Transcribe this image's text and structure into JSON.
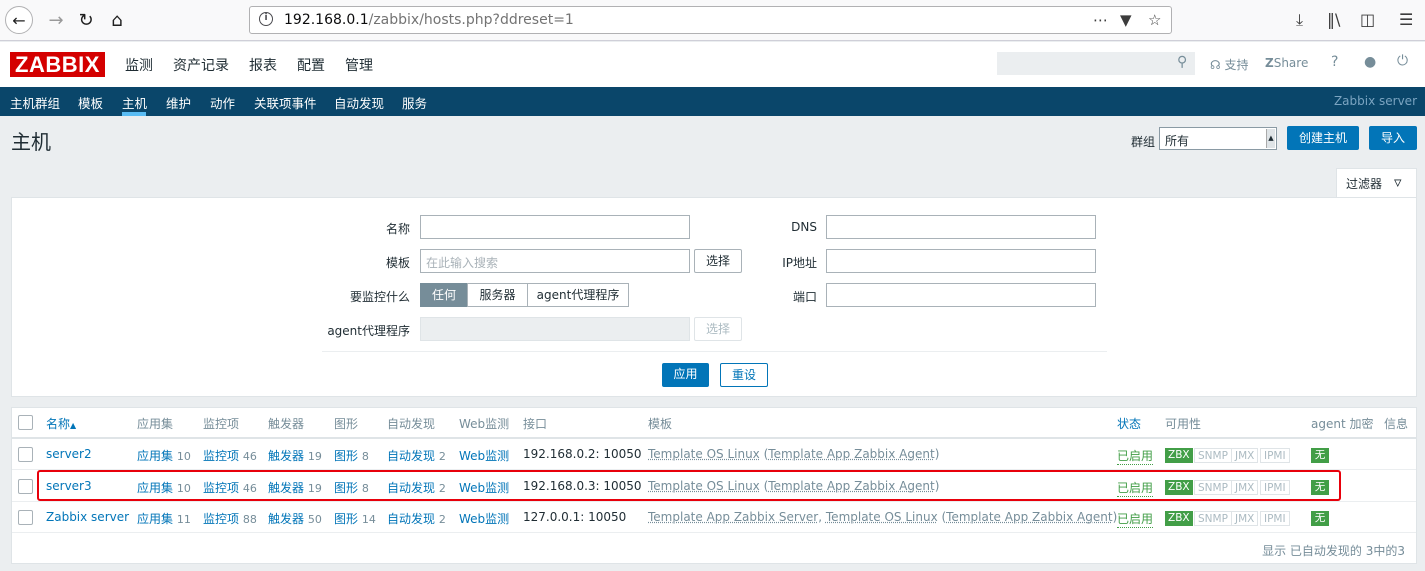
{
  "browser": {
    "url_host": "192.168.0.1",
    "url_path": "/zabbix/hosts.php?ddreset=1"
  },
  "header": {
    "logo": "ZABBIX",
    "menu": [
      "监测",
      "资产记录",
      "报表",
      "配置",
      "管理"
    ],
    "support": "支持",
    "share": "Share",
    "help": "?"
  },
  "subnav": {
    "items": [
      "主机群组",
      "模板",
      "主机",
      "维护",
      "动作",
      "关联项事件",
      "自动发现",
      "服务"
    ],
    "server_name": "Zabbix server"
  },
  "page": {
    "title": "主机",
    "group_label": "群组",
    "group_value": "所有",
    "create_button": "创建主机",
    "import_button": "导入"
  },
  "filter": {
    "tab_label": "过滤器",
    "name_label": "名称",
    "template_label": "模板",
    "template_placeholder": "在此输入搜索",
    "select_button": "选择",
    "monitored_by_label": "要监控什么",
    "monitored_options": [
      "任何",
      "服务器",
      "agent代理程序"
    ],
    "proxy_label": "agent代理程序",
    "dns_label": "DNS",
    "ip_label": "IP地址",
    "port_label": "端口",
    "apply_button": "应用",
    "reset_button": "重设"
  },
  "table": {
    "columns": {
      "name": "名称",
      "name_sort": "▲",
      "apps": "应用集",
      "items": "监控项",
      "triggers": "触发器",
      "graphs": "图形",
      "discovery": "自动发现",
      "web": "Web监测",
      "interface": "接口",
      "templates": "模板",
      "status": "状态",
      "availability": "可用性",
      "encryption": "agent 加密",
      "info": "信息"
    },
    "rows": [
      {
        "name": "server2",
        "apps_label": "应用集",
        "apps_count": "10",
        "items_label": "监控项",
        "items_count": "46",
        "triggers_label": "触发器",
        "triggers_count": "19",
        "graphs_label": "图形",
        "graphs_count": "8",
        "discovery_label": "自动发现",
        "discovery_count": "2",
        "web_label": "Web监测",
        "interface": "192.168.0.2: 10050",
        "tpl1": "Template OS Linux",
        "tpl_open": " (",
        "tpl2": "Template App Zabbix Agent",
        "tpl_close": ")",
        "status": "已启用",
        "avail": [
          "ZBX",
          "SNMP",
          "JMX",
          "IPMI"
        ],
        "encryption": "无"
      },
      {
        "name": "server3",
        "apps_label": "应用集",
        "apps_count": "10",
        "items_label": "监控项",
        "items_count": "46",
        "triggers_label": "触发器",
        "triggers_count": "19",
        "graphs_label": "图形",
        "graphs_count": "8",
        "discovery_label": "自动发现",
        "discovery_count": "2",
        "web_label": "Web监测",
        "interface": "192.168.0.3: 10050",
        "tpl1": "Template OS Linux",
        "tpl_open": " (",
        "tpl2": "Template App Zabbix Agent",
        "tpl_close": ")",
        "status": "已启用",
        "avail": [
          "ZBX",
          "SNMP",
          "JMX",
          "IPMI"
        ],
        "encryption": "无"
      },
      {
        "name": "Zabbix server",
        "apps_label": "应用集",
        "apps_count": "11",
        "items_label": "监控项",
        "items_count": "88",
        "triggers_label": "触发器",
        "triggers_count": "50",
        "graphs_label": "图形",
        "graphs_count": "14",
        "discovery_label": "自动发现",
        "discovery_count": "2",
        "web_label": "Web监测",
        "interface": "127.0.0.1: 10050",
        "tpl0": "Template App Zabbix Server",
        "tpl_sep": ", ",
        "tpl1": "Template OS Linux",
        "tpl_open": " (",
        "tpl2": "Template App Zabbix Agent",
        "tpl_close": ")",
        "status": "已启用",
        "avail": [
          "ZBX",
          "SNMP",
          "JMX",
          "IPMI"
        ],
        "encryption": "无"
      }
    ],
    "footer": "显示 已自动发现的 3中的3"
  }
}
